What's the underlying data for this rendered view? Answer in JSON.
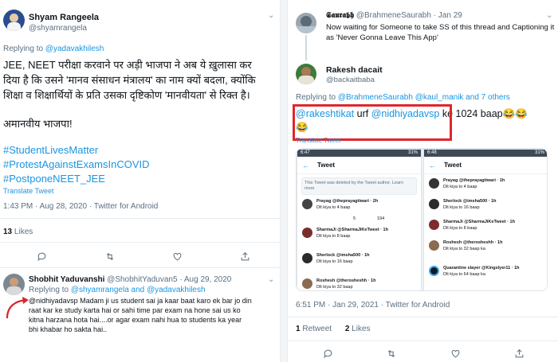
{
  "left": {
    "tweet1": {
      "name": "Shyam Rangeela",
      "handle": "@shyamrangela",
      "replying_prefix": "Replying to ",
      "replying_to": "@yadavakhilesh",
      "body_line1": "JEE, NEET परीक्षा करवाने पर अड़ी भाजपा ने अब ये ख़ुलासा कर",
      "body_line2": "दिया है कि उसने 'मानव संसाधन मंत्रालय' का नाम क्यों बदला, क्योंकि",
      "body_line3": "शिक्षा व शिक्षार्थियों के प्रति उसका दृष्टिकोण 'मानवीयता' से रिक्त है।",
      "body_line4": "अमानवीय भाजपा!",
      "hashtag1": "#StudentLivesMatter",
      "hashtag2": "#ProtestAgainstExamsInCOVID",
      "hashtag3": "#PostponeNEET_JEE",
      "translate": "Translate Tweet",
      "timestamp": "1:43 PM · Aug 28, 2020 · Twitter for Android",
      "likes_count": "13",
      "likes_label": "Likes"
    },
    "tweet2": {
      "name": "Shobhit Yaduvanshi",
      "handle_date": "@ShobhitYaduvan5 · Aug 29, 2020",
      "replying_prefix": "Replying to ",
      "replying_to": "@shyamrangela and @yadavakhilesh",
      "body_line1": "@nidhiyadavsp Madam ji us student sai ja kaar baat karo ek bar jo din",
      "body_line2": "raat kar ke study karta hai or sahi time par exam na hone sai us ko",
      "body_line3": "kitna harzana hota hai....or agar exam nahi hua to students ka year",
      "body_line4": "bhi khabar ho sakta hai.."
    }
  },
  "right": {
    "tweet1": {
      "name": "𝕾𝖆𝖚𝖗𝖆𝖇𝖍",
      "handle_date": "@BrahmeneSaurabh · Jan 29",
      "body_line1": "Now waiting for Someone to take  SS of this thread and Captioning it",
      "body_line2": "as 'Never Gonna Leave This App'"
    },
    "tweet2": {
      "name": "Rakesh dacait",
      "handle": "@backaitbaba",
      "replying_prefix": "Replying to ",
      "replying_to": "@BrahmeneSaurabh @kaul_manik and 7 others",
      "mention1": "@rakeshtikat",
      "text_mid": " urf ",
      "mention2": "@nidhiyadavsp",
      "text_end": " ke 1024 baap😂😂",
      "text_line2": "😂",
      "translate": "Translate Tweet",
      "timestamp": "6:51 PM · Jan 29, 2021 · Twitter for Android",
      "retweets_count": "1",
      "retweets_label": "Retweet",
      "likes_count": "2",
      "likes_label": "Likes"
    },
    "screenshot": {
      "left_phone": {
        "time": "6:47",
        "battery": "31%",
        "title": "Tweet",
        "deleted": "This Tweet was deleted by the Tweet author. Learn more",
        "items": [
          {
            "head": "Prayag @theprayagtiwari · 2h",
            "body": "Dlt kiya to 4 baap"
          },
          {
            "head": "SharmaJi @SharmaJiKeTweet · 1h",
            "body": "Dlt kiya to 8 baap"
          },
          {
            "head": "Sherlock @imsha500 · 1h",
            "body": "Dlt kiya to 16 baap"
          },
          {
            "head": "Roshesh @therosheshh · 1h",
            "body": "Dlt kiya to 32 baap"
          }
        ],
        "counts": [
          "5",
          "194"
        ]
      },
      "right_phone": {
        "time": "6:48",
        "battery": "31%",
        "title": "Tweet",
        "items": [
          {
            "head": "Prayag @theprayagtiwari · 1h",
            "body": "Dlt kiya to 4 baap"
          },
          {
            "head": "Sherlock @imsha500 · 1h",
            "body": "Dlt kiya to 16 baap"
          },
          {
            "head": "SharmaJi @SharmaJiKeTweet · 1h",
            "body": "Dlt kiya to 8 baap"
          },
          {
            "head": "Roshesh @therosheshh · 1h",
            "body": "Dlt kiya to 32 baap ka"
          },
          {
            "head": "Quarantine slayer @Kingslyer11 · 1h",
            "body": "Dlt kiya to 64 baap ka"
          }
        ]
      }
    }
  },
  "colors": {
    "link": "#1b95e0",
    "highlight_box": "#e0262b",
    "arrow": "#d7262b"
  }
}
